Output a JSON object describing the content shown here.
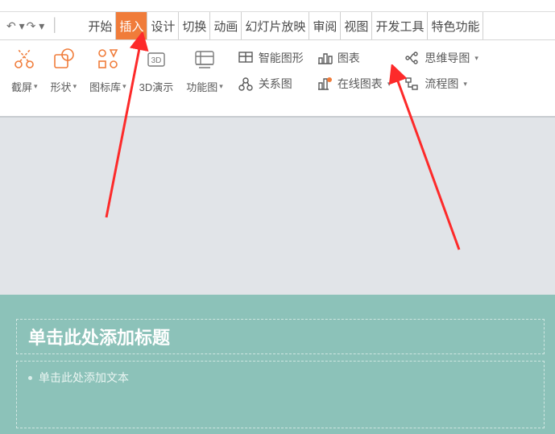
{
  "qat": {
    "undo": "↶",
    "redo": "↷",
    "sep": "│"
  },
  "tabs": {
    "items": [
      {
        "label": "开始"
      },
      {
        "label": "插入"
      },
      {
        "label": "设计"
      },
      {
        "label": "切换"
      },
      {
        "label": "动画"
      },
      {
        "label": "幻灯片放映"
      },
      {
        "label": "审阅"
      },
      {
        "label": "视图"
      },
      {
        "label": "开发工具"
      },
      {
        "label": "特色功能"
      }
    ],
    "active_index": 1
  },
  "ribbon": {
    "big": [
      {
        "label": "截屏",
        "caret": true,
        "icon": "scissors-icon"
      },
      {
        "label": "形状",
        "caret": true,
        "icon": "shape-icon"
      },
      {
        "label": "图标库",
        "caret": true,
        "icon": "icon-library-icon"
      },
      {
        "label": "3D演示",
        "caret": false,
        "icon": "cube-3d-icon"
      },
      {
        "label": "功能图",
        "caret": true,
        "icon": "function-diagram-icon"
      }
    ],
    "col1": [
      {
        "label": "智能图形",
        "icon": "smart-graphic-icon"
      },
      {
        "label": "关系图",
        "icon": "relation-diagram-icon"
      }
    ],
    "col2": [
      {
        "label": "图表",
        "icon": "chart-icon"
      },
      {
        "label": "在线图表",
        "caret": true,
        "icon": "online-chart-icon"
      }
    ],
    "col3": [
      {
        "label": "思维导图",
        "caret": true,
        "icon": "mindmap-icon"
      },
      {
        "label": "流程图",
        "caret": true,
        "icon": "flowchart-icon"
      }
    ]
  },
  "slide": {
    "title_placeholder": "单击此处添加标题",
    "body_placeholder": "单击此处添加文本"
  }
}
